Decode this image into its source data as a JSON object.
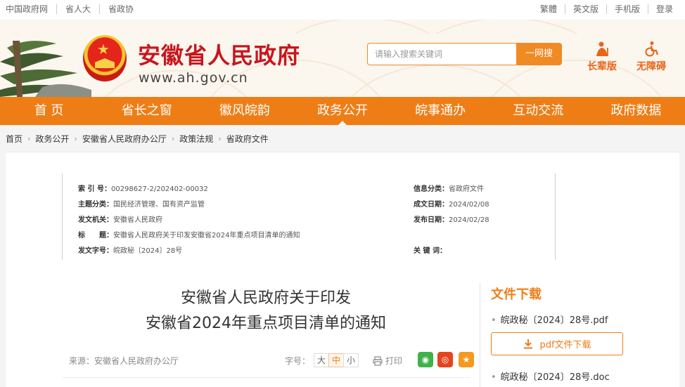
{
  "topbar": {
    "left_links": [
      "中国政府网",
      "省人大",
      "省政协"
    ],
    "right_links": [
      "繁體",
      "英文版",
      "手机版",
      "登录"
    ]
  },
  "header": {
    "site_title": "安徽省人民政府",
    "site_url": "www.ah.gov.cn",
    "search_placeholder": "请输入搜索关键词",
    "search_button": "一网搜",
    "elder_mode": "长辈版",
    "accessibility": "无障碍"
  },
  "nav": {
    "items": [
      "首 页",
      "省长之窗",
      "徽风皖韵",
      "政务公开",
      "皖事通办",
      "互动交流",
      "政府数据"
    ],
    "active_index": 3
  },
  "breadcrumb": [
    "首页",
    "政务公开",
    "安徽省人民政府办公厅",
    "政策法规",
    "省政府文件"
  ],
  "meta": {
    "index_label": "索 引 号：",
    "index_value": "00298627-2/202402-00032",
    "info_category_label": "信息分类：",
    "info_category_value": "省政府文件",
    "topic_label": "主题分类：",
    "topic_value": "国民经济管理、国有资产监管",
    "created_label": "成文日期：",
    "created_value": "2024/02/08",
    "issuer_label": "发文机关：",
    "issuer_value": "安徽省人民政府",
    "published_label": "发布日期：",
    "published_value": "2024/02/28",
    "title_label": "标　　题：",
    "title_value": "安徽省人民政府关于印发安徽省2024年重点项目清单的通知",
    "doc_no_label": "发文字号：",
    "doc_no_value": "皖政秘〔2024〕28号",
    "keywords_label": "关 键 词：",
    "keywords_value": ""
  },
  "document": {
    "title_line1": "安徽省人民政府关于印发",
    "title_line2": "安徽省2024年重点项目清单的通知",
    "source": "来源：安徽省人民政府办公厅",
    "font_size_label": "字号：",
    "font_sizes": [
      "大",
      "中",
      "小"
    ],
    "active_font_size": "中",
    "print": "打印"
  },
  "downloads": {
    "title": "文件下载",
    "pdf_name": "皖政秘〔2024〕28号.pdf",
    "pdf_button": "pdf文件下载",
    "doc_name": "皖政秘〔2024〕28号.doc"
  },
  "colors": {
    "brand_orange": "#ef7d16",
    "title_red": "#c8161d"
  }
}
